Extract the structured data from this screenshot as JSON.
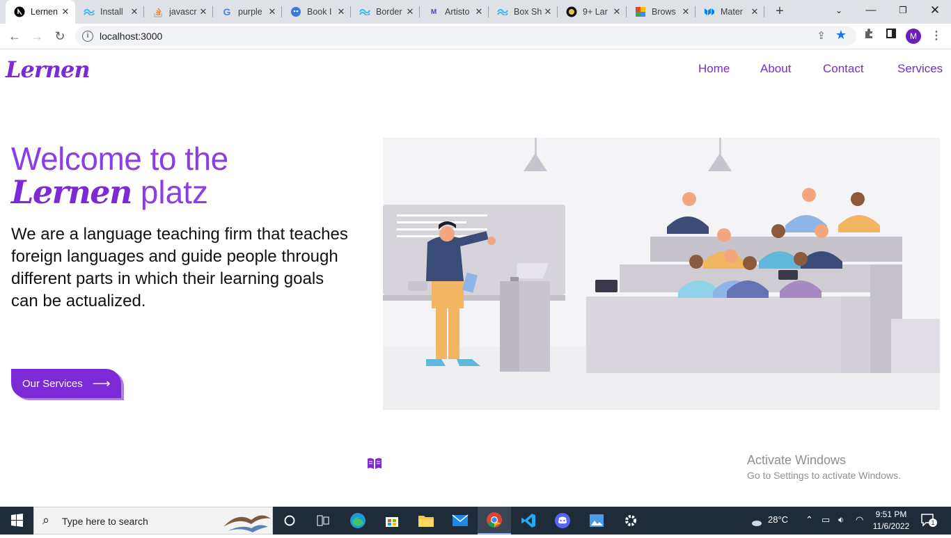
{
  "browser": {
    "tabs": [
      {
        "title": "Lernen",
        "icon": "nextjs-icon",
        "active": true
      },
      {
        "title": "Install",
        "icon": "tailwind-icon"
      },
      {
        "title": "javascr",
        "icon": "stackoverflow-icon"
      },
      {
        "title": "purple",
        "icon": "google-icon"
      },
      {
        "title": "Book I",
        "icon": "robot-icon"
      },
      {
        "title": "Border",
        "icon": "tailwind-icon"
      },
      {
        "title": "Artisto",
        "icon": "medium-icon"
      },
      {
        "title": "Box Sh",
        "icon": "tailwind-icon"
      },
      {
        "title": "9+ Lar",
        "icon": "shield-icon"
      },
      {
        "title": "Brows",
        "icon": "colorful-icon"
      },
      {
        "title": "Mater",
        "icon": "mui-icon"
      }
    ],
    "url": "localhost:3000",
    "profile_initial": "M"
  },
  "site": {
    "logo": "Lernen",
    "nav": [
      "Home",
      "About",
      "Contact",
      "Services"
    ],
    "hero": {
      "heading_line1": "Welcome to the",
      "heading_brand": "Lernen",
      "heading_rest": " platz",
      "lead": "We are a language teaching firm that teaches foreign languages and guide people through different parts in which their learning goals can be actualized.",
      "cta": "Our Services"
    }
  },
  "watermark": {
    "title": "Activate Windows",
    "subtitle": "Go to Settings to activate Windows."
  },
  "taskbar": {
    "search_placeholder": "Type here to search",
    "weather": "28°C",
    "time": "9:51 PM",
    "date": "11/6/2022",
    "notification_count": "1"
  },
  "colors": {
    "brand": "#7b2ad6",
    "heading": "#8b3ee6",
    "cta_shadow": "#b07ce8"
  }
}
